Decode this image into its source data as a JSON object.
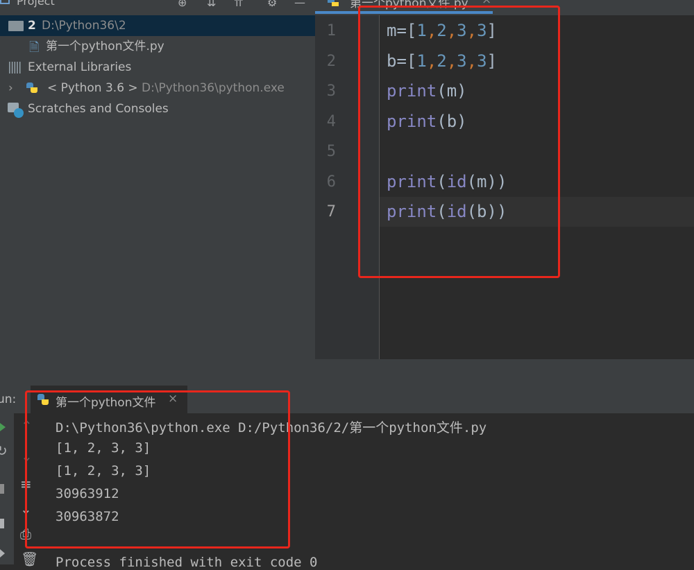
{
  "project": {
    "title": "Project",
    "root_name": "2",
    "root_path": "D:\\Python36\\2",
    "file_name": "第一个python文件.py",
    "external_libraries": "External Libraries",
    "sdk_name": "< Python 3.6 >",
    "sdk_path": "D:\\Python36\\python.exe",
    "scratches": "Scratches and Consoles"
  },
  "editor": {
    "tab_label": "第一个python文件.py",
    "line_numbers": [
      "1",
      "2",
      "3",
      "4",
      "5",
      "6",
      "7"
    ],
    "code": {
      "l1_var": "m",
      "l1_eq": "=[",
      "n1": "1",
      "n2": "2",
      "n3": "3",
      "n4": "3",
      "c": ",",
      "close_br": "]",
      "l2_var": "b",
      "print": "print",
      "id": "id",
      "p_m": "(m)",
      "p_b": "(b)",
      "open_p": "(",
      "id_m": "(m))",
      "id_b": "(b))"
    }
  },
  "run": {
    "label": "un:",
    "tab_label": "第一个python文件",
    "tab_close": "×",
    "output": [
      "D:\\Python36\\python.exe D:/Python36/2/第一个python文件.py",
      "[1, 2, 3, 3]",
      "[1, 2, 3, 3]",
      "30963912",
      "30963872",
      "",
      "Process finished with exit code 0"
    ]
  },
  "colors": {
    "annotation_red": "#e8261c",
    "keyword": "#8888c6",
    "number": "#6897bb",
    "comma": "#cc7832"
  }
}
